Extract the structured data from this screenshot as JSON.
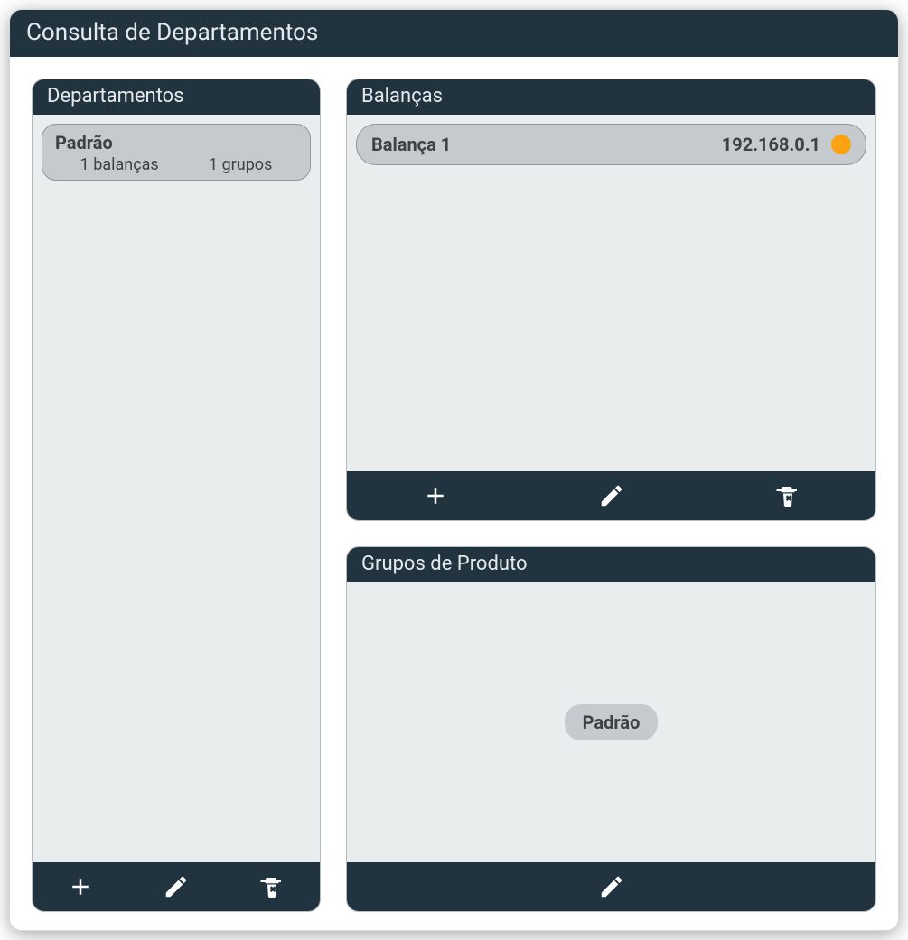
{
  "window": {
    "title": "Consulta de Departamentos"
  },
  "panels": {
    "departamentos": {
      "title": "Departamentos",
      "items": [
        {
          "name": "Padrão",
          "balancas_text": "1 balanças",
          "grupos_text": "1 grupos"
        }
      ]
    },
    "balancas": {
      "title": "Balanças",
      "items": [
        {
          "name": "Balança 1",
          "ip": "192.168.0.1",
          "status_color": "#fca311"
        }
      ]
    },
    "grupos": {
      "title": "Grupos de Produto",
      "items": [
        {
          "name": "Padrão"
        }
      ]
    }
  },
  "icons": {
    "add": "add-icon",
    "edit": "pencil-icon",
    "delete": "trash-x-icon"
  }
}
